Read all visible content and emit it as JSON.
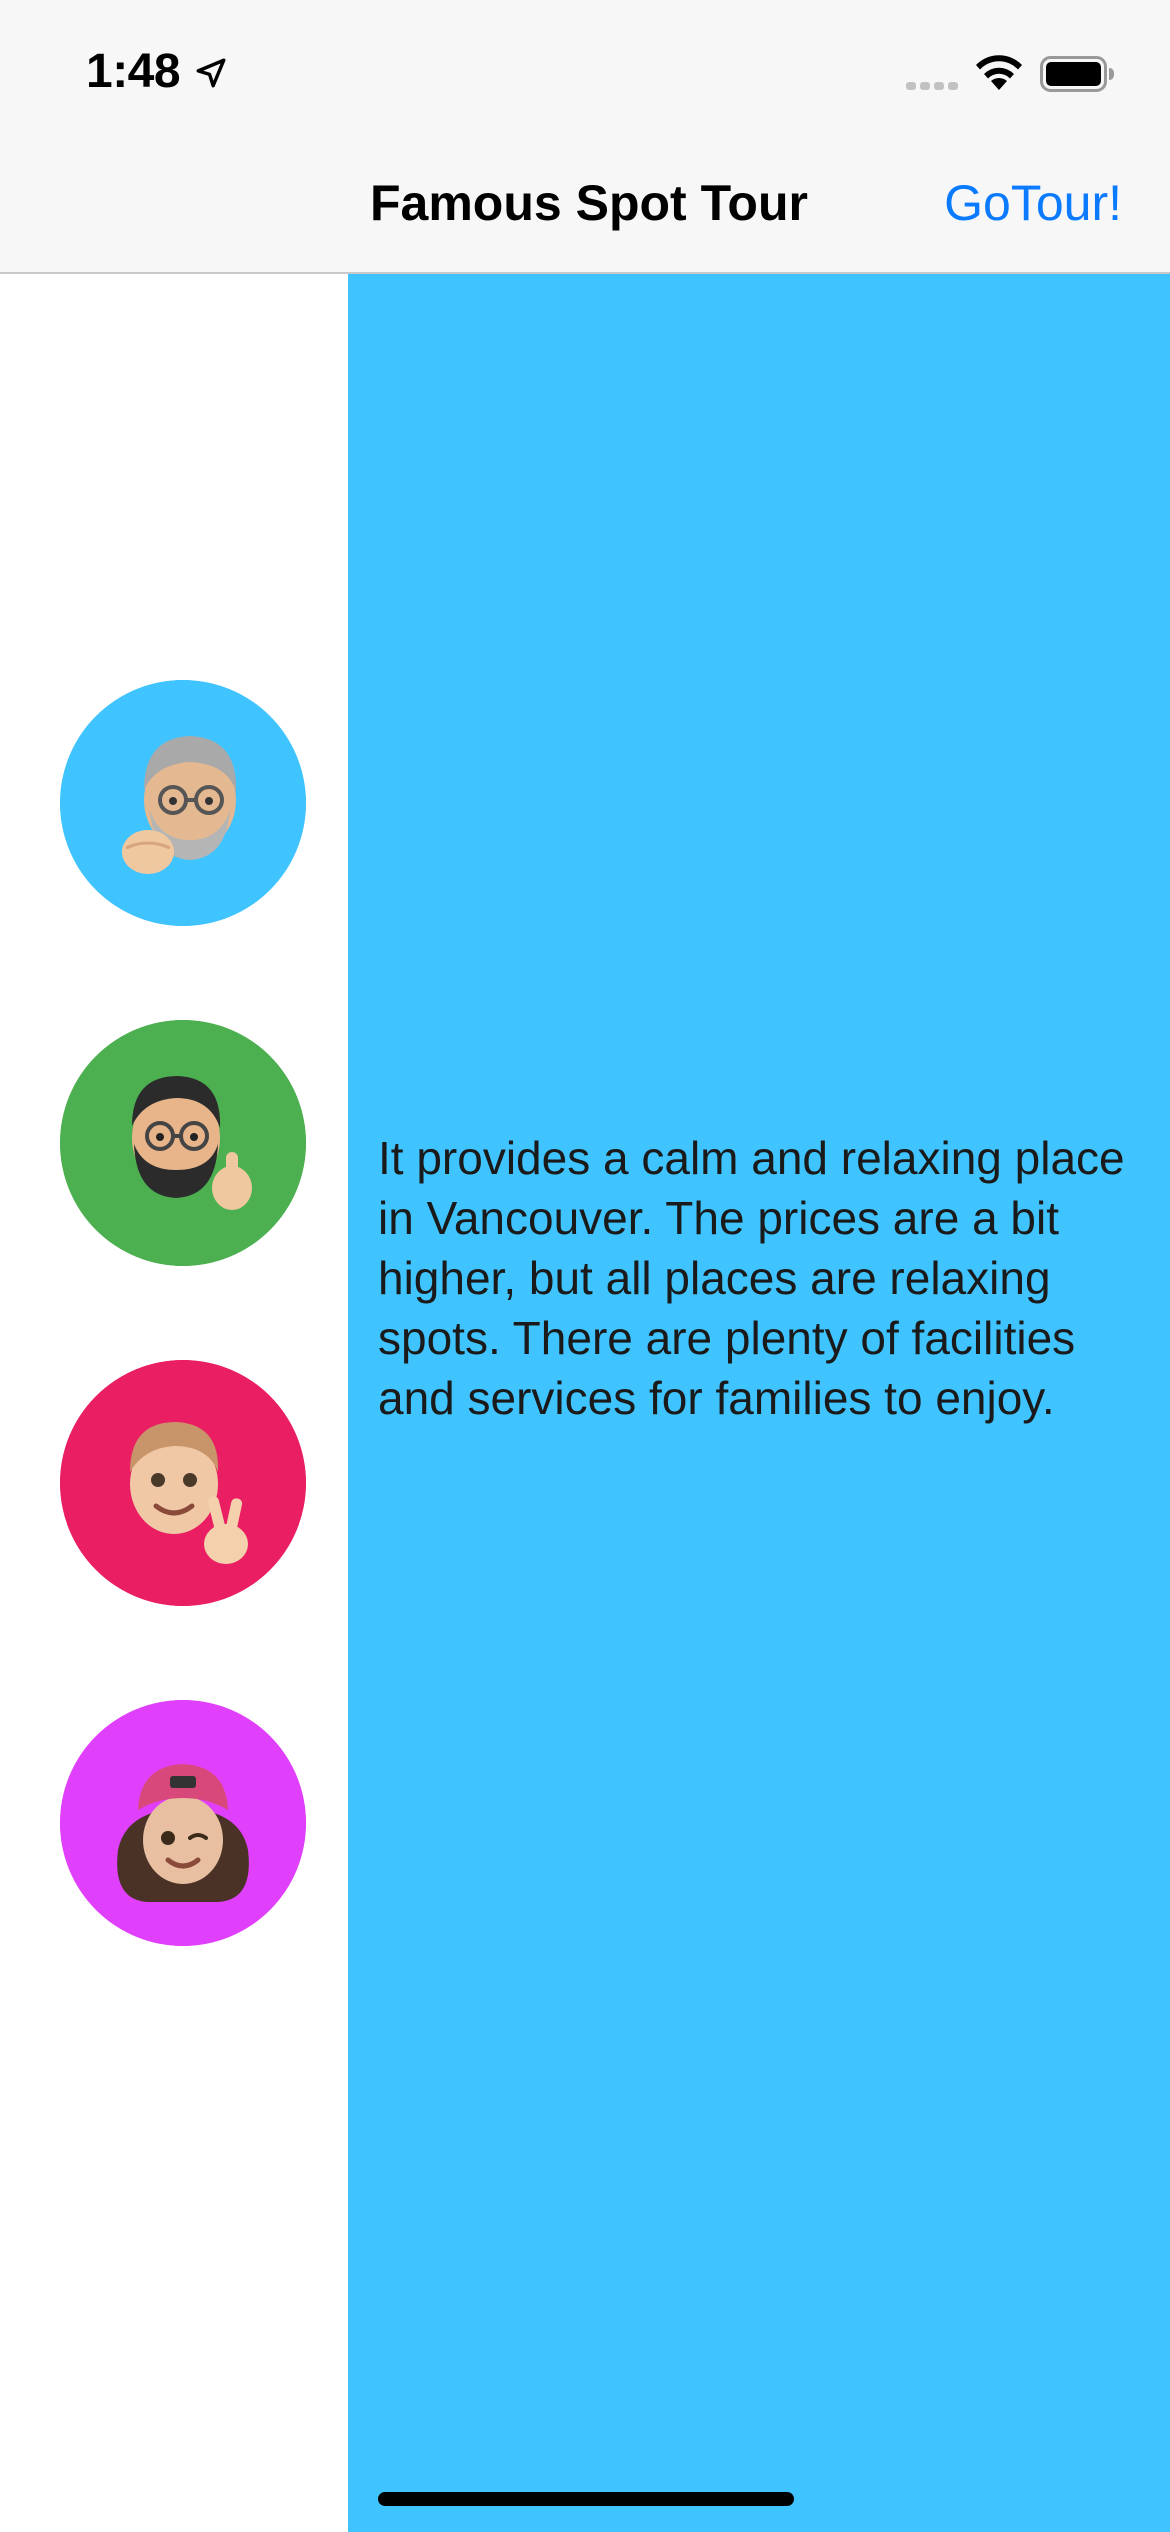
{
  "status_bar": {
    "time": "1:48"
  },
  "nav": {
    "title": "Famous Spot Tour",
    "action_label": "GoTour!",
    "action_color": "#0a7aff"
  },
  "avatars": [
    {
      "name": "gray-haired man memoji with fist",
      "bg": "#40c4ff"
    },
    {
      "name": "bearded man memoji with thumbs up",
      "bg": "#4caf50"
    },
    {
      "name": "smiling person memoji with peace sign",
      "bg": "#e91e63"
    },
    {
      "name": "winking woman memoji with pink cap",
      "bg": "#e040fb"
    }
  ],
  "content": {
    "description": "It provides a calm and relaxing place in Vancouver. The prices are a bit higher, but all places are relaxing spots. There are plenty of facilities and services for families to enjoy.",
    "bg": "#40c4ff"
  }
}
